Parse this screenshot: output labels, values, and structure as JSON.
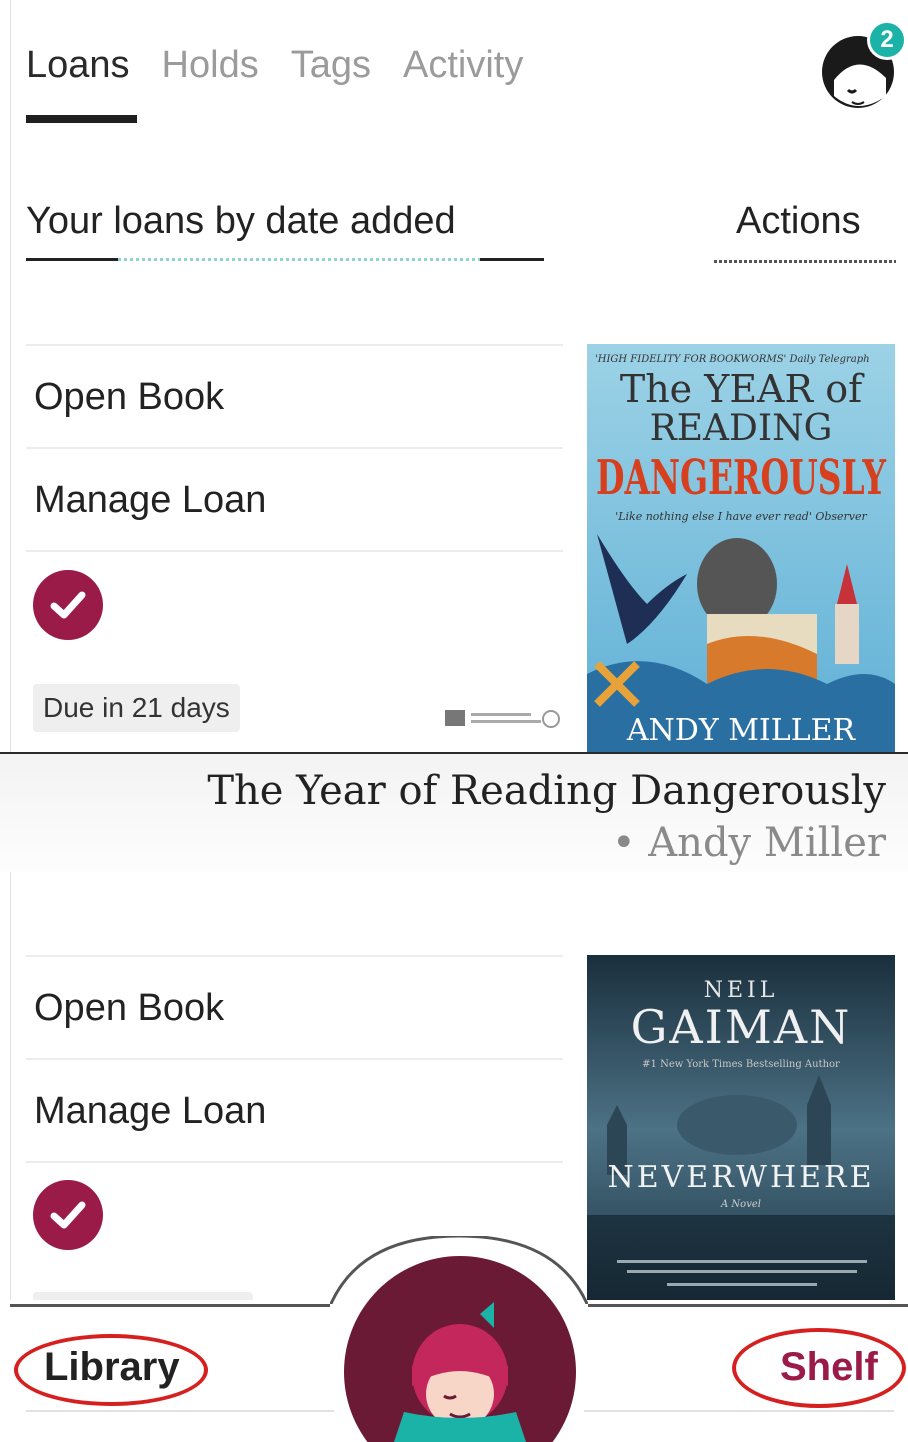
{
  "tabs": [
    {
      "label": "Loans",
      "active": true
    },
    {
      "label": "Holds",
      "active": false
    },
    {
      "label": "Tags",
      "active": false
    },
    {
      "label": "Activity",
      "active": false
    }
  ],
  "notifications": {
    "count": "2"
  },
  "sort": {
    "label": "Your loans by date added",
    "actions_label": "Actions"
  },
  "loans": [
    {
      "open_label": "Open Book",
      "manage_label": "Manage Loan",
      "due": "Due in 21 days",
      "title": "The Year of Reading Dangerously",
      "author": "• Andy Miller",
      "cover": {
        "quote": "'HIGH FIDELITY FOR BOOKWORMS' Daily Telegraph",
        "line1": "The YEAR of",
        "line2": "READING",
        "line3": "DANGEROUSLY",
        "quote2": "'Like nothing else I have ever read' Observer",
        "author": "ANDY MILLER"
      }
    },
    {
      "open_label": "Open Book",
      "manage_label": "Manage Loan",
      "cover": {
        "author_first": "NEIL",
        "author_last": "GAIMAN",
        "tagline": "#1 New York Times Bestselling Author",
        "title": "NEVERWHERE",
        "subtitle": "A Novel"
      }
    }
  ],
  "bottom_nav": {
    "library": "Library",
    "shelf": "Shelf"
  },
  "colors": {
    "accent": "#9a1b47",
    "teal": "#1bb3a8",
    "annotation": "#d62020"
  }
}
